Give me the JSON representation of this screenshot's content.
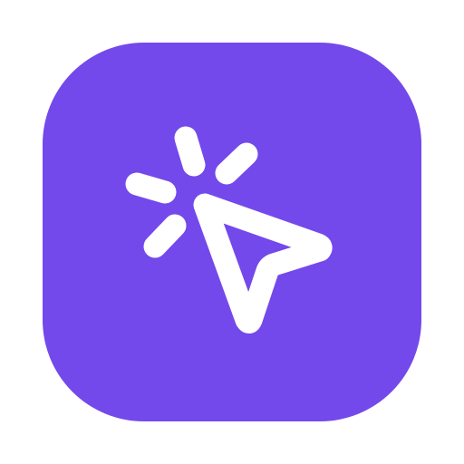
{
  "icon": {
    "name": "click-cursor-icon",
    "background_color": "#7349EB",
    "glyph_color": "#FFFFFF"
  }
}
